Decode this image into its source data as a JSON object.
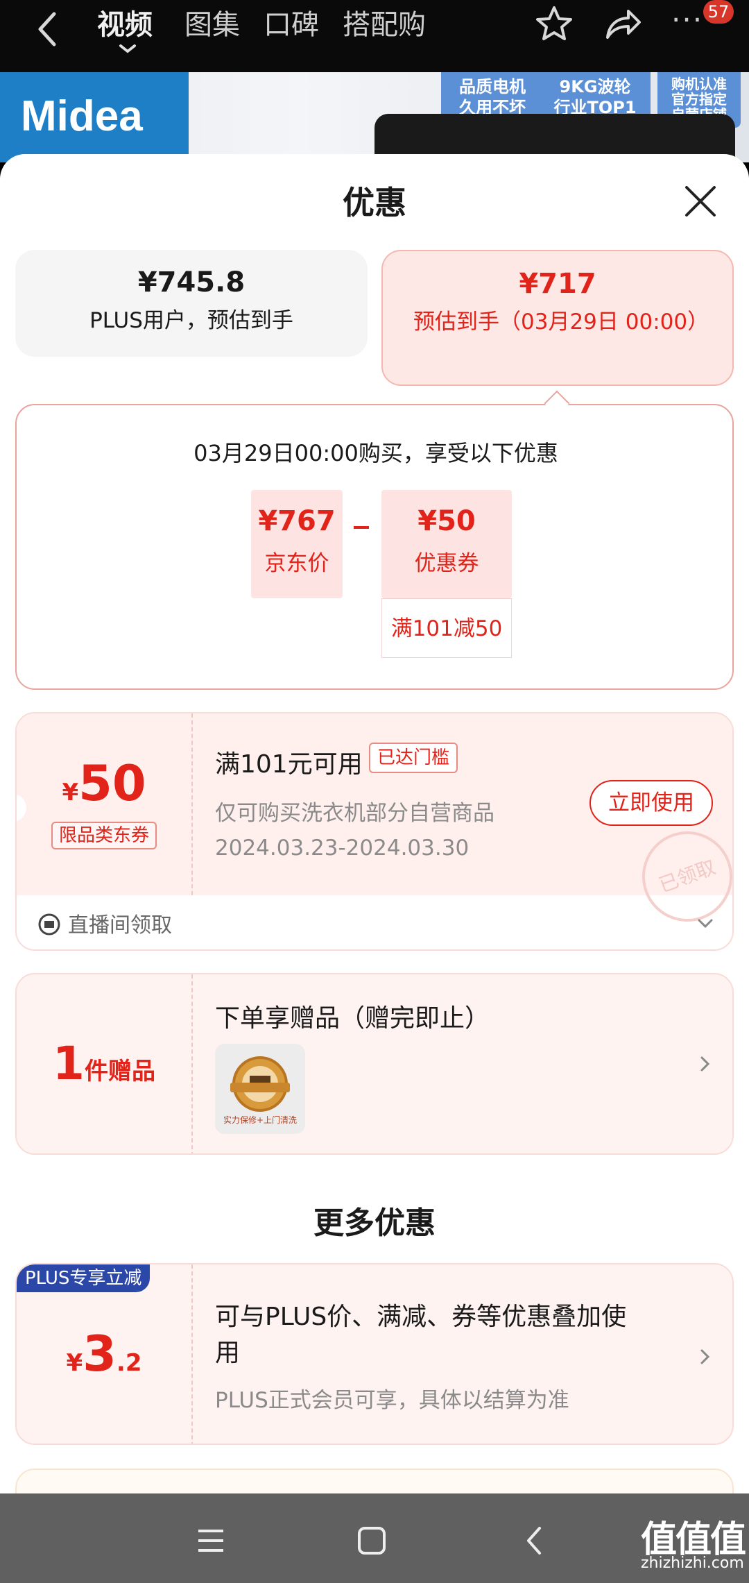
{
  "topnav": {
    "tabs": [
      "视频",
      "图集",
      "口碑",
      "搭配购"
    ],
    "active_tab": "视频",
    "badge_count": "57"
  },
  "banner": {
    "brand": "Midea",
    "tags": [
      "品质电机\n久用不坏",
      "9KG波轮\n行业TOP1",
      "购机认准\n官方指定\n自营店铺"
    ]
  },
  "sheet": {
    "title": "优惠",
    "price_left": {
      "price": "¥745.8",
      "label": "PLUS用户，预估到手"
    },
    "price_right": {
      "price": "¥717",
      "label": "预估到手（03月29日 00:00）"
    },
    "detail": {
      "title": "03月29日00:00购买，享受以下优惠",
      "base_price": "¥767",
      "base_label": "京东价",
      "discount": "¥50",
      "discount_label": "优惠券",
      "discount_condition": "满101减50"
    },
    "coupon": {
      "yen": "¥",
      "amount": "50",
      "type": "限品类东券",
      "condition": "满101元可用",
      "reached": "已达门槛",
      "scope": "仅可购买洗衣机部分自营商品",
      "validity": "2024.03.23-2024.03.30",
      "use_button": "立即使用",
      "stamp": "已领取",
      "source": "直播间领取"
    },
    "gift": {
      "count": "1",
      "unit": "件赠品",
      "title": "下单享赠品（赠完即止）",
      "image_caption": "实力保修+上门清洗"
    },
    "more_title": "更多优惠",
    "plus": {
      "tag": "PLUS专享立减",
      "yen": "¥",
      "amount": "3",
      "decimal": ".2",
      "title": "可与PLUS价、满减、券等优惠叠加使用",
      "subtitle": "PLUS正式会员可享，具体以结算为准"
    }
  },
  "watermark": {
    "main": "值值值",
    "sub": "zhizhizhi.com"
  },
  "colors": {
    "accent": "#e2231a",
    "plus_tag": "#2b47a7",
    "brand_blue": "#1f7fc6"
  }
}
